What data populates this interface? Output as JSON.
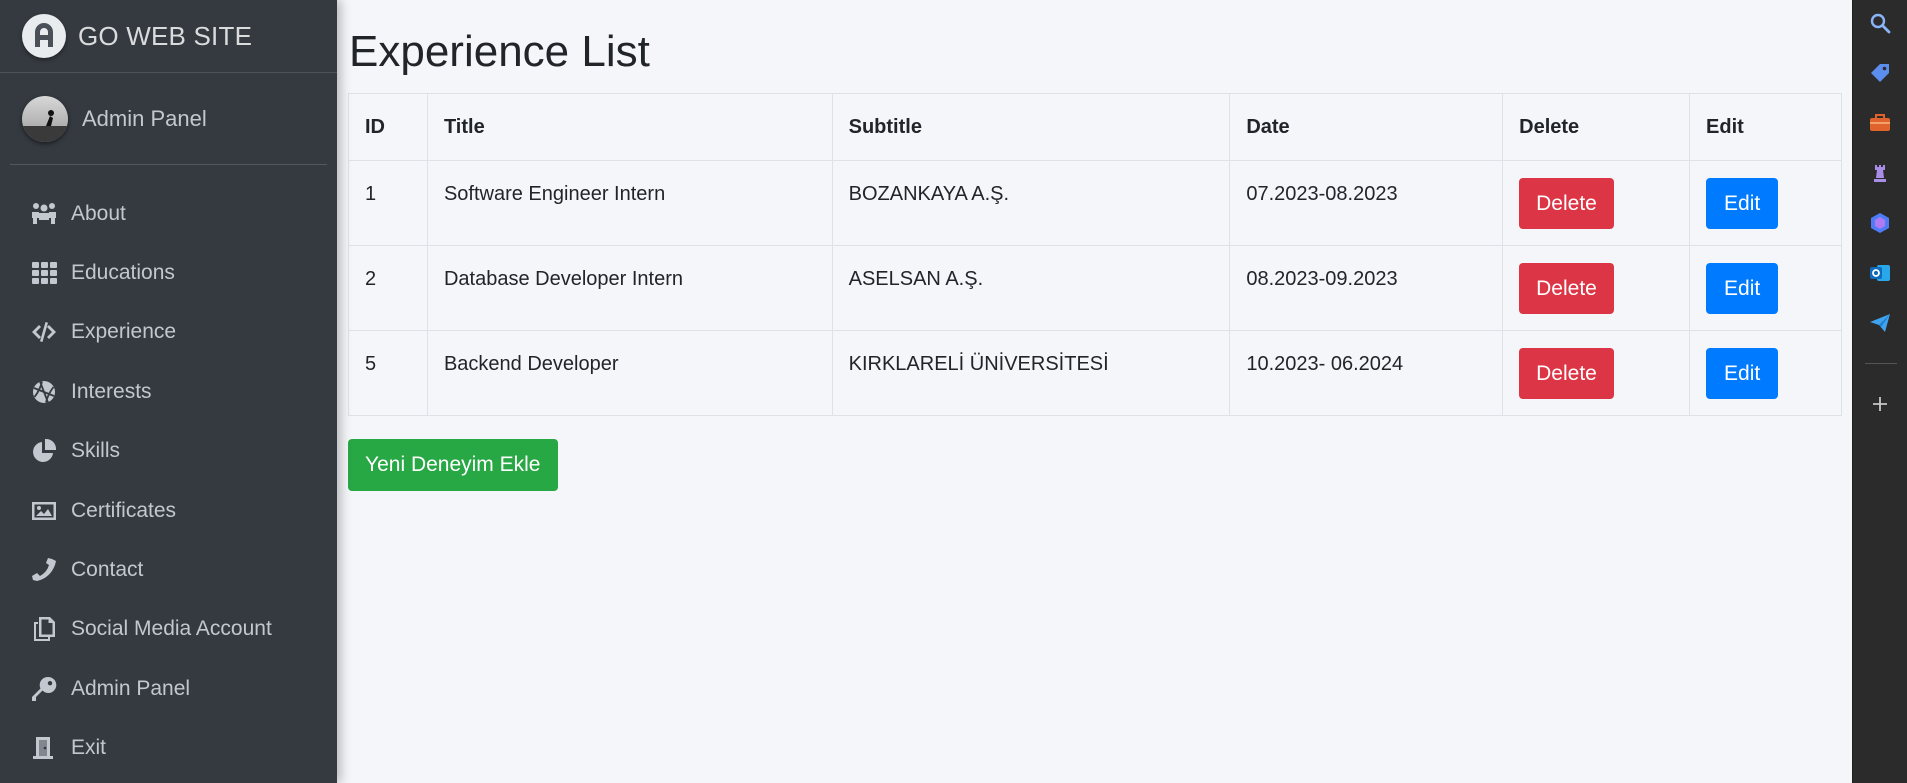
{
  "brand": {
    "name": "GO WEB SITE"
  },
  "user": {
    "name": "Admin Panel"
  },
  "sidebar": {
    "items": [
      {
        "label": "About",
        "icon": "users-icon"
      },
      {
        "label": "Educations",
        "icon": "grid-icon"
      },
      {
        "label": "Experience",
        "icon": "code-icon"
      },
      {
        "label": "Interests",
        "icon": "basketball-icon"
      },
      {
        "label": "Skills",
        "icon": "pie-chart-icon"
      },
      {
        "label": "Certificates",
        "icon": "image-icon"
      },
      {
        "label": "Contact",
        "icon": "phone-icon"
      },
      {
        "label": "Social Media Account",
        "icon": "copy-icon"
      },
      {
        "label": "Admin Panel",
        "icon": "key-icon"
      },
      {
        "label": "Exit",
        "icon": "door-icon"
      }
    ]
  },
  "main": {
    "title": "Experience List",
    "table": {
      "headers": [
        "ID",
        "Title",
        "Subtitle",
        "Date",
        "Delete",
        "Edit"
      ],
      "rows": [
        {
          "id": "1",
          "title": "Software Engineer Intern",
          "subtitle": "BOZANKAYA A.Ş.",
          "date": "07.2023-08.2023",
          "delete": "Delete",
          "edit": "Edit"
        },
        {
          "id": "2",
          "title": "Database Developer Intern",
          "subtitle": "ASELSAN A.Ş.",
          "date": "08.2023-09.2023",
          "delete": "Delete",
          "edit": "Edit"
        },
        {
          "id": "5",
          "title": "Backend Developer",
          "subtitle": "KIRKLARELİ ÜNİVERSİTESİ",
          "date": "10.2023- 06.2024",
          "delete": "Delete",
          "edit": "Edit"
        }
      ]
    },
    "add_button": "Yeni Deneyim Ekle"
  },
  "colors": {
    "sidebar_bg": "#343a40",
    "content_bg": "#f4f6f9",
    "danger": "#dc3545",
    "primary": "#007bff",
    "success": "#28a745"
  },
  "browser_sidebar": {
    "icons": [
      "search-icon",
      "tag-icon",
      "briefcase-icon",
      "chess-icon",
      "copilot-icon",
      "outlook-icon",
      "send-icon",
      "plus-icon"
    ]
  }
}
